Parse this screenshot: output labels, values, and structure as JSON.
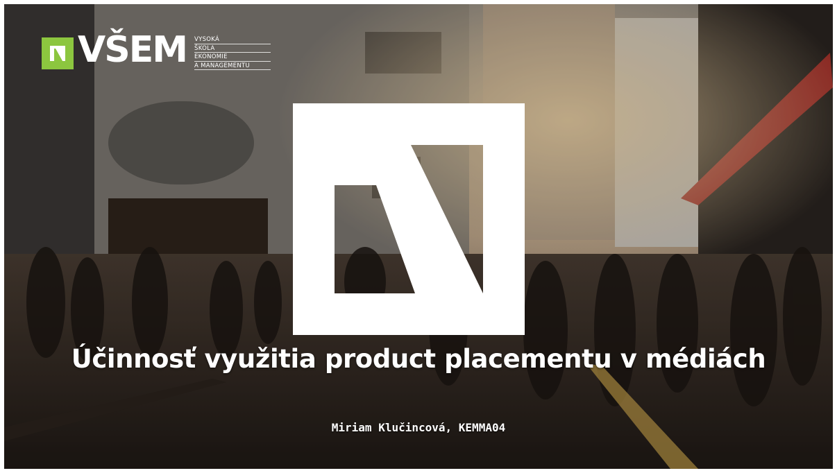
{
  "slide": {
    "logo": {
      "wordmark": "VŠEM",
      "tagline": [
        "VYSOKÁ",
        "ŠKOLA",
        "EKONOMIE",
        "A MANAGEMENTU"
      ],
      "accent_color": "#8cc63f"
    },
    "title": "Účinnosť využitia product placementu v médiách",
    "subtitle": "Miriam Klučincová,  KEMMA04",
    "background": "street-crowd-photo",
    "mark_icon": "vsem-quadrant-mark-icon"
  }
}
